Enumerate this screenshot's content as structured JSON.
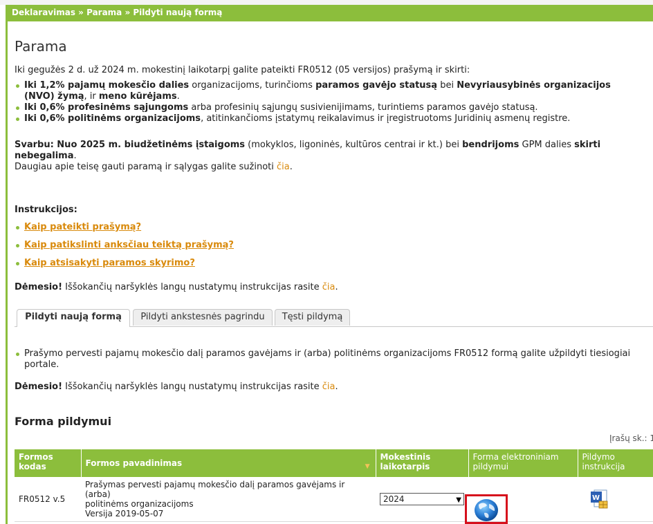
{
  "breadcrumb": "Deklaravimas » Parama » Pildyti naują formą",
  "page_title": "Parama",
  "intro": "Iki gegužės 2 d. už 2024 m. mokestinį laikotarpį galite pateikti FR0512 (05 versijos) prašymą ir skirti:",
  "bullets": {
    "b1_bold1": "Iki 1,2% pajamų mokesčio dalies",
    "b1_t1": " organizacijoms, turinčioms ",
    "b1_bold2": "paramos gavėjo statusą",
    "b1_t2": " bei ",
    "b1_bold3": "Nevyriausybinės organizacijos",
    "b1_bold4": "(NVO) žymą",
    "b1_t3": ", ir ",
    "b1_bold5": "meno kūrėjams",
    "b1_t4": ".",
    "b2_bold": "Iki 0,6% profesinėms sąjungoms",
    "b2_t": " arba profesinių sąjungų susivienijimams, turintiems paramos gavėjo statusą.",
    "b3_bold": "Iki 0,6% politinėms organizacijoms",
    "b3_t": ", atitinkančioms įstatymų reikalavimus ir įregistruotoms Juridinių asmenų registre."
  },
  "important": {
    "bold1": "Svarbu: Nuo 2025 m. biudžetinėms įstaigoms",
    "t1": " (mokyklos, ligoninės, kultūros centrai ir kt.) bei ",
    "bold2": "bendrijoms",
    "t2": " GPM dalies ",
    "bold3": "skirti",
    "bold4": "nebegalima",
    "t3": ".",
    "more_text": "Daugiau apie teisę gauti paramą ir sąlygas galite sužinoti ",
    "more_link": "čia",
    "more_end": "."
  },
  "instructions": {
    "title": "Instrukcijos:",
    "items": [
      "Kaip pateikti prašymą?",
      "Kaip patikslinti anksčiau teiktą prašymą?",
      "Kaip atsisakyti paramos skyrimo?"
    ]
  },
  "attention": {
    "bold": "Dėmesio!",
    "text": " Iššokančių naršyklės langų nustatymų instrukcijas rasite ",
    "link": "čia",
    "end": "."
  },
  "tabs": [
    "Pildyti naują formą",
    "Pildyti ankstesnės pagrindu",
    "Tęsti pildymą"
  ],
  "tab_content": {
    "line1": "Prašymo pervesti pajamų mokesčio dalį paramos gavėjams ir (arba) politinėms organizacijoms FR0512 formą galite užpildyti tiesiogiai",
    "line2": "portale."
  },
  "section_title": "Forma pildymui",
  "records_count": "Įrašų sk.: 1",
  "table": {
    "headers": {
      "code_1": "Formos",
      "code_2": "kodas",
      "name": "Formos pavadinimas",
      "period_1": "Mokestinis",
      "period_2": "laikotarpis",
      "online_1": "Forma elektroniniam",
      "online_2": "pildymui",
      "instr_1": "Pildymo",
      "instr_2": "instrukcija"
    },
    "row": {
      "code": "FR0512 v.5",
      "name_1": "Prašymas pervesti pajamų mokesčio dalį paramos gavėjams ir (arba)",
      "name_2": "politinėms organizacijoms",
      "version": "Versija 2019-05-07",
      "period": "2024"
    }
  },
  "colors": {
    "green": "#8cbe3c",
    "link": "#d98a0c",
    "highlight": "#d6101c"
  },
  "icons": [
    "globe-icon",
    "word-document-icon",
    "sort-arrow-icon",
    "chevron-down-icon"
  ]
}
